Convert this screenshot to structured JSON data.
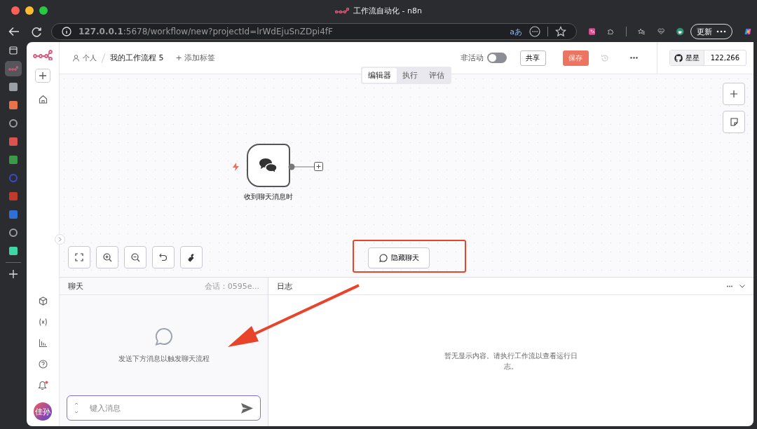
{
  "browser": {
    "title": "工作流自动化 - n8n",
    "url": "**127.0.0.1**:5678/workflow/new?projectId=lrWdEjuSnZDpi4fF",
    "translate_label": "aあ",
    "update_button": "更新"
  },
  "breadcrumb": {
    "owner": "个人",
    "workflow": "我的工作流程 5",
    "add_tag": "+ 添加标签"
  },
  "activation": {
    "label": "非活动",
    "on": false
  },
  "share_button": "共享",
  "save_button": "保存",
  "github": {
    "label": "星星",
    "count": "122,266"
  },
  "view_tabs": [
    {
      "label": "编辑器",
      "selected": true
    },
    {
      "label": "执行",
      "selected": false
    },
    {
      "label": "评估",
      "selected": false
    }
  ],
  "node": {
    "label": "收到聊天消息时"
  },
  "hide_chat_button": "隐藏聊天",
  "chat": {
    "title": "聊天",
    "session": "会话：0595e...",
    "empty_text": "发送下方消息以触发聊天流程",
    "input_placeholder": "键入消息"
  },
  "logs": {
    "title": "日志",
    "empty_text": "暂无显示内容。请执行工作流以查看运行日志。"
  },
  "user": {
    "initials": "佳孙"
  },
  "notifications": {
    "unread": true
  }
}
